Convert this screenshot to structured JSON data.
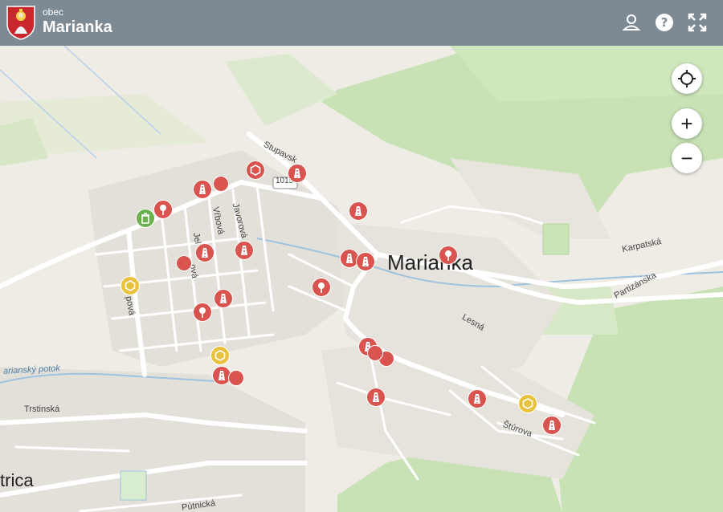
{
  "header": {
    "pretitle": "obec",
    "title": "Marianka",
    "colors": {
      "bar": "#7d8a94",
      "text": "#ffffff"
    }
  },
  "toolbar": {
    "icons": [
      "user-icon",
      "help-icon",
      "fullscreen-icon"
    ]
  },
  "map_controls": {
    "locate_icon": "crosshair-icon",
    "zoom_in_label": "+",
    "zoom_out_label": "−"
  },
  "map": {
    "colors": {
      "forest": "#c8e2b5",
      "road": "#ffffff",
      "residential": "#e4e1da",
      "marker_red": "#d9534f",
      "marker_yellow": "#e8c23e",
      "marker_green": "#6ab04c"
    },
    "labels": {
      "town": "Marianka",
      "town_partial": "trica",
      "road_number": "1015",
      "streets": [
        "Stupavsk",
        "Javorová",
        "Vŕbová",
        "Jel",
        "ová",
        "Karpatská",
        "Partizánska",
        "Lesná",
        "Štúrova",
        "Trstinská",
        "Pútnická",
        "pová"
      ],
      "stream": "arianský potok"
    }
  }
}
